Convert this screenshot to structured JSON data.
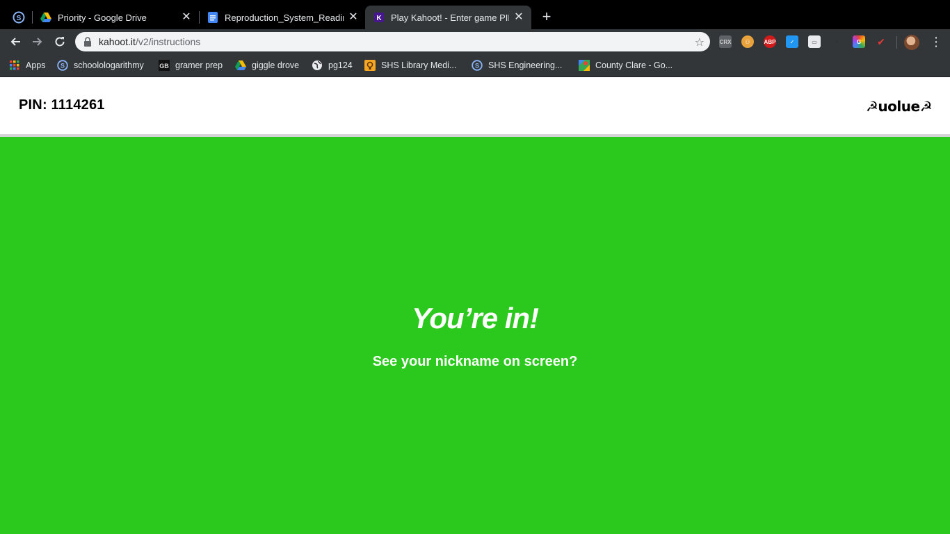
{
  "browser": {
    "tabs": [
      {
        "title": "Priority - Google Drive",
        "icon": "google-drive-icon",
        "active": false
      },
      {
        "title": "Reproduction_System_Reading",
        "icon": "google-docs-icon",
        "active": false
      },
      {
        "title": "Play Kahoot! - Enter game PIN",
        "icon": "kahoot-icon",
        "active": true
      }
    ],
    "pinned_tab_icon": "schoology-icon",
    "url_host": "kahoot.it",
    "url_path": "/v2/instructions",
    "extensions": [
      "CRX",
      "ABP"
    ]
  },
  "bookmarks": [
    {
      "label": "Apps",
      "icon": "apps-grid-icon"
    },
    {
      "label": "schoolologarithmy",
      "icon": "schoology-icon"
    },
    {
      "label": "gramer prep",
      "icon": "gb-icon"
    },
    {
      "label": "giggle drove",
      "icon": "google-drive-icon"
    },
    {
      "label": "pg124",
      "icon": "globe-icon"
    },
    {
      "label": "SHS Library Medi...",
      "icon": "library-icon"
    },
    {
      "label": "SHS Engineering...",
      "icon": "schoology-icon"
    },
    {
      "label": "County Clare - Go...",
      "icon": "google-maps-icon"
    }
  ],
  "page": {
    "pin_label": "PIN: 1114261",
    "logo_text": "☭uolue☭",
    "heading": "You’re in!",
    "subheading": "See your nickname on screen?",
    "background_color": "#2bc91d"
  }
}
